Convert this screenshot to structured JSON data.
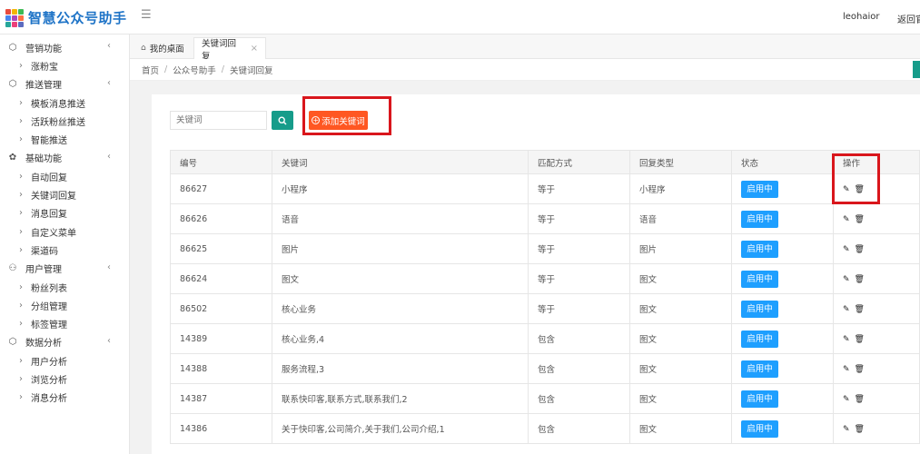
{
  "header": {
    "app_title": "智慧公众号助手",
    "menu_icon": "hamburger-icon",
    "user_name": "leohaior",
    "back_link": "返回官网"
  },
  "colors": {
    "brand": "#1f74c7",
    "teal": "#169c8a",
    "orange": "#ff5722",
    "status_blue": "#1e9fff",
    "highlight_red": "#d9161c"
  },
  "sidebar": {
    "groups": [
      {
        "label": "营销功能",
        "icon": "cube-icon",
        "items": [
          "涨粉宝"
        ]
      },
      {
        "label": "推送管理",
        "icon": "cube-icon",
        "items": [
          "模板消息推送",
          "活跃粉丝推送",
          "智能推送"
        ]
      },
      {
        "label": "基础功能",
        "icon": "flower-icon",
        "items": [
          "自动回复",
          "关键词回复",
          "消息回复",
          "自定义菜单",
          "渠道码"
        ]
      },
      {
        "label": "用户管理",
        "icon": "user-icon",
        "items": [
          "粉丝列表",
          "分组管理",
          "标签管理"
        ]
      },
      {
        "label": "数据分析",
        "icon": "cube-icon",
        "items": [
          "用户分析",
          "浏览分析",
          "消息分析"
        ]
      }
    ]
  },
  "tabs": {
    "home": "我的桌面",
    "active": "关键词回复"
  },
  "breadcrumb": [
    "首页",
    "公众号助手",
    "关键词回复"
  ],
  "toolbar": {
    "search_placeholder": "关键词",
    "add_label": "添加关键词"
  },
  "table": {
    "columns": [
      "编号",
      "关键词",
      "匹配方式",
      "回复类型",
      "状态",
      "操作"
    ],
    "rows": [
      {
        "id": "86627",
        "keyword": "小程序",
        "match": "等于",
        "type": "小程序",
        "status": "启用中"
      },
      {
        "id": "86626",
        "keyword": "语音",
        "match": "等于",
        "type": "语音",
        "status": "启用中"
      },
      {
        "id": "86625",
        "keyword": "图片",
        "match": "等于",
        "type": "图片",
        "status": "启用中"
      },
      {
        "id": "86624",
        "keyword": "图文",
        "match": "等于",
        "type": "图文",
        "status": "启用中"
      },
      {
        "id": "86502",
        "keyword": "核心业务",
        "match": "等于",
        "type": "图文",
        "status": "启用中"
      },
      {
        "id": "14389",
        "keyword": "核心业务,4",
        "match": "包含",
        "type": "图文",
        "status": "启用中"
      },
      {
        "id": "14388",
        "keyword": "服务流程,3",
        "match": "包含",
        "type": "图文",
        "status": "启用中"
      },
      {
        "id": "14387",
        "keyword": "联系快印客,联系方式,联系我们,2",
        "match": "包含",
        "type": "图文",
        "status": "启用中"
      },
      {
        "id": "14386",
        "keyword": "关于快印客,公司简介,关于我们,公司介绍,1",
        "match": "包含",
        "type": "图文",
        "status": "启用中"
      }
    ]
  }
}
